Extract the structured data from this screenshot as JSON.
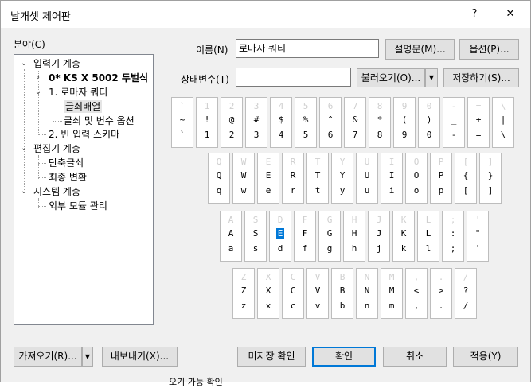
{
  "title": "날개셋 제어판",
  "title_buttons": {
    "help": "?",
    "close": "✕"
  },
  "category_label": "분야(C)",
  "tree": {
    "input_layer": "입력기 계층",
    "ks_x_5002": "0* KS X 5002 두벌식",
    "romaja_qwerty": "1. 로마자 쿼티",
    "key_layout": "글쇠배열",
    "keys_vars": "글쇠 및 변수 옵션",
    "blank_schema": "2. 빈 입력 스키마",
    "editor_layer": "편집기 계층",
    "shortcut_keys": "단축글쇠",
    "final_convert": "최종 변환",
    "system_layer": "시스템 계층",
    "external_modules": "외부 모듈 관리"
  },
  "name_label": "이름(N)",
  "name_value": "로마자 쿼티",
  "description_button": "설명문(M)...",
  "options_button": "옵션(P)...",
  "state_var_label": "상태변수(T)",
  "state_var_value": "",
  "load_button": "불러오기(O)...",
  "save_button": "저장하기(S)...",
  "keyboard": {
    "row1": [
      {
        "e": "`",
        "s": "~",
        "n": "`"
      },
      {
        "e": "1",
        "s": "!",
        "n": "1"
      },
      {
        "e": "2",
        "s": "@",
        "n": "2"
      },
      {
        "e": "3",
        "s": "#",
        "n": "3"
      },
      {
        "e": "4",
        "s": "$",
        "n": "4"
      },
      {
        "e": "5",
        "s": "%",
        "n": "5"
      },
      {
        "e": "6",
        "s": "^",
        "n": "6"
      },
      {
        "e": "7",
        "s": "&",
        "n": "7"
      },
      {
        "e": "8",
        "s": "*",
        "n": "8"
      },
      {
        "e": "9",
        "s": "(",
        "n": "9"
      },
      {
        "e": "0",
        "s": ")",
        "n": "0"
      },
      {
        "e": "-",
        "s": "_",
        "n": "-"
      },
      {
        "e": "=",
        "s": "+",
        "n": "="
      },
      {
        "e": "\\",
        "s": "|",
        "n": "\\"
      }
    ],
    "row2": [
      {
        "e": "Q",
        "s": "Q",
        "n": "q"
      },
      {
        "e": "W",
        "s": "W",
        "n": "w"
      },
      {
        "e": "E",
        "s": "E",
        "n": "e"
      },
      {
        "e": "R",
        "s": "R",
        "n": "r"
      },
      {
        "e": "T",
        "s": "T",
        "n": "t"
      },
      {
        "e": "Y",
        "s": "Y",
        "n": "y"
      },
      {
        "e": "U",
        "s": "U",
        "n": "u"
      },
      {
        "e": "I",
        "s": "I",
        "n": "i"
      },
      {
        "e": "O",
        "s": "O",
        "n": "o"
      },
      {
        "e": "P",
        "s": "P",
        "n": "p"
      },
      {
        "e": "[",
        "s": "{",
        "n": "["
      },
      {
        "e": "]",
        "s": "}",
        "n": "]"
      }
    ],
    "row3": [
      {
        "e": "A",
        "s": "A",
        "n": "a"
      },
      {
        "e": "S",
        "s": "S",
        "n": "s"
      },
      {
        "e": "D",
        "s": "E",
        "n": "d",
        "hi": true
      },
      {
        "e": "F",
        "s": "F",
        "n": "f"
      },
      {
        "e": "G",
        "s": "G",
        "n": "g"
      },
      {
        "e": "H",
        "s": "H",
        "n": "h"
      },
      {
        "e": "J",
        "s": "J",
        "n": "j"
      },
      {
        "e": "K",
        "s": "K",
        "n": "k"
      },
      {
        "e": "L",
        "s": "L",
        "n": "l"
      },
      {
        "e": ";",
        "s": ":",
        "n": ";"
      },
      {
        "e": "'",
        "s": "\"",
        "n": "'"
      }
    ],
    "row4": [
      {
        "e": "Z",
        "s": "Z",
        "n": "z"
      },
      {
        "e": "X",
        "s": "X",
        "n": "x"
      },
      {
        "e": "C",
        "s": "C",
        "n": "c"
      },
      {
        "e": "V",
        "s": "V",
        "n": "v"
      },
      {
        "e": "B",
        "s": "B",
        "n": "b"
      },
      {
        "e": "N",
        "s": "N",
        "n": "n"
      },
      {
        "e": "M",
        "s": "M",
        "n": "m"
      },
      {
        "e": ",",
        "s": "<",
        "n": ","
      },
      {
        "e": ".",
        "s": ">",
        "n": "."
      },
      {
        "e": "/",
        "s": "?",
        "n": "/"
      }
    ]
  },
  "import_button": "가져오기(R)...",
  "export_button": "내보내기(X)...",
  "unsaved_check_button": "미저장 확인",
  "ok_button": "확인",
  "cancel_button": "취소",
  "apply_button": "적용(Y)",
  "bleed_text": "오기 가능 확인"
}
